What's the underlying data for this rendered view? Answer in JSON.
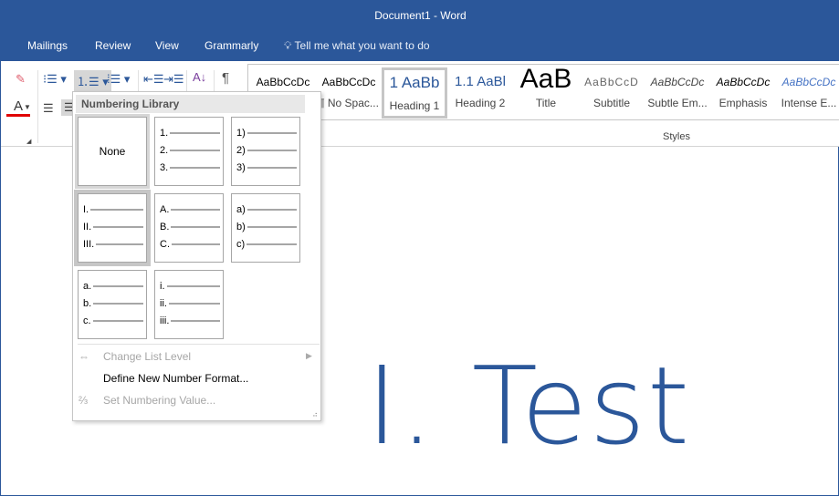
{
  "window": {
    "title": "Document1  -  Word"
  },
  "tabs": [
    "Mailings",
    "Review",
    "View",
    "Grammarly"
  ],
  "tell_me": "Tell me what you want to do",
  "styles": {
    "items": [
      {
        "preview": "AaBbCcDc",
        "name": ""
      },
      {
        "preview": "AaBbCcDc",
        "name": "¶ No Spac..."
      },
      {
        "preview": "1  AaBb",
        "name": "Heading 1",
        "selected": true
      },
      {
        "preview": "1.1  AaBl",
        "name": "Heading 2"
      },
      {
        "preview": "AaB",
        "name": "Title"
      },
      {
        "preview": "AaBbCcD",
        "name": "Subtitle"
      },
      {
        "preview": "AaBbCcDc",
        "name": "Subtle Em..."
      },
      {
        "preview": "AaBbCcDc",
        "name": "Emphasis"
      },
      {
        "preview": "AaBbCcDc",
        "name": "Intense E..."
      }
    ],
    "group_label": "Styles"
  },
  "numbering_menu": {
    "header": "Numbering Library",
    "none_label": "None",
    "formats": [
      [
        "1.",
        "2.",
        "3."
      ],
      [
        "1)",
        "2)",
        "3)"
      ],
      [
        "I.",
        "II.",
        "III."
      ],
      [
        "A.",
        "B.",
        "C."
      ],
      [
        "a)",
        "b)",
        "c)"
      ],
      [
        "a.",
        "b.",
        "c."
      ],
      [
        "i.",
        "ii.",
        "iii."
      ]
    ],
    "items": [
      {
        "label": "Change List Level",
        "disabled": true
      },
      {
        "label": "Define New Number Format...",
        "disabled": false
      },
      {
        "label": "Set Numbering Value...",
        "disabled": true
      }
    ]
  },
  "document": {
    "text": "I. Test"
  },
  "colors": {
    "accent": "#2b579a",
    "font_color": "#e00000"
  }
}
